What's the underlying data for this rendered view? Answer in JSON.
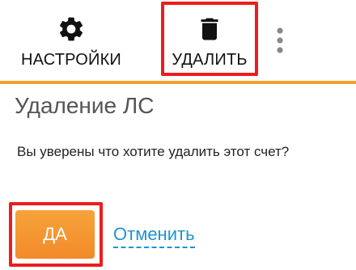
{
  "toolbar": {
    "settings": {
      "label": "НАСТРОЙКИ",
      "icon": "gear-icon"
    },
    "delete": {
      "label": "УДАЛИТЬ",
      "icon": "trash-icon"
    },
    "more": {
      "icon": "more-vertical-icon"
    }
  },
  "dialog": {
    "title": "Удаление ЛС",
    "question": "Вы уверены что хотите удалить этот счет?",
    "confirm_label": "ДА",
    "cancel_label": "Отменить"
  },
  "colors": {
    "accent": "#f2a02e",
    "confirm_button": "#f38a2a",
    "link": "#1e93d2",
    "highlight": "#ee1c1c"
  }
}
